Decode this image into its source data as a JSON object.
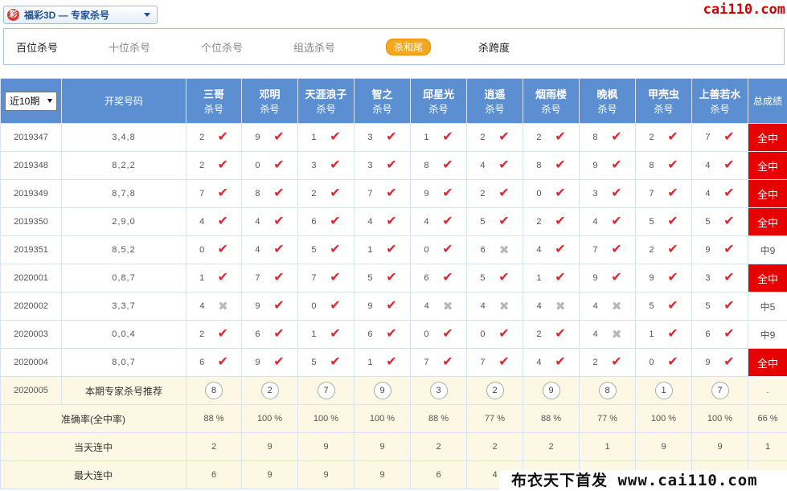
{
  "header": {
    "logo_glyph": "彩",
    "game_title": "福彩3D — 专家杀号",
    "site_mark": "cai110.com"
  },
  "tabs": [
    {
      "label": "百位杀号",
      "state": "selected-text"
    },
    {
      "label": "十位杀号",
      "state": "normal"
    },
    {
      "label": "个位杀号",
      "state": "normal"
    },
    {
      "label": "组选杀号",
      "state": "normal"
    },
    {
      "label": "杀和尾",
      "state": "active"
    },
    {
      "label": "杀跨度",
      "state": "dark"
    }
  ],
  "table": {
    "period_select": "近10期",
    "draw_header": "开奖号码",
    "result_header": "总成绩",
    "experts": [
      {
        "name": "三哥",
        "sub": "杀号"
      },
      {
        "name": "邓明",
        "sub": "杀号"
      },
      {
        "name": "天涯浪子",
        "sub": "杀号"
      },
      {
        "name": "智之",
        "sub": "杀号"
      },
      {
        "name": "邱星光",
        "sub": "杀号"
      },
      {
        "name": "逍遥",
        "sub": "杀号"
      },
      {
        "name": "烟雨楼",
        "sub": "杀号"
      },
      {
        "name": "晚枫",
        "sub": "杀号"
      },
      {
        "name": "甲壳虫",
        "sub": "杀号"
      },
      {
        "name": "上善若水",
        "sub": "杀号"
      }
    ],
    "rows": [
      {
        "issue": "2019347",
        "draw": "3,4,8",
        "picks": [
          "2",
          "9",
          "1",
          "3",
          "1",
          "2",
          "2",
          "8",
          "2",
          "7"
        ],
        "hits": [
          1,
          1,
          1,
          1,
          1,
          1,
          1,
          1,
          1,
          1
        ],
        "result": "全中"
      },
      {
        "issue": "2019348",
        "draw": "8,2,2",
        "picks": [
          "2",
          "0",
          "3",
          "3",
          "8",
          "4",
          "8",
          "9",
          "8",
          "4"
        ],
        "hits": [
          1,
          1,
          1,
          1,
          1,
          1,
          1,
          1,
          1,
          1
        ],
        "result": "全中"
      },
      {
        "issue": "2019349",
        "draw": "8,7,8",
        "picks": [
          "7",
          "8",
          "2",
          "7",
          "9",
          "2",
          "0",
          "3",
          "7",
          "4"
        ],
        "hits": [
          1,
          1,
          1,
          1,
          1,
          1,
          1,
          1,
          1,
          1
        ],
        "result": "全中"
      },
      {
        "issue": "2019350",
        "draw": "2,9,0",
        "picks": [
          "4",
          "4",
          "6",
          "4",
          "4",
          "5",
          "2",
          "4",
          "5",
          "5"
        ],
        "hits": [
          1,
          1,
          1,
          1,
          1,
          1,
          1,
          1,
          1,
          1
        ],
        "result": "全中"
      },
      {
        "issue": "2019351",
        "draw": "8,5,2",
        "picks": [
          "0",
          "4",
          "5",
          "1",
          "0",
          "6",
          "4",
          "7",
          "2",
          "9"
        ],
        "hits": [
          1,
          1,
          1,
          1,
          1,
          0,
          1,
          1,
          1,
          1
        ],
        "result": "中9"
      },
      {
        "issue": "2020001",
        "draw": "0,8,7",
        "picks": [
          "1",
          "7",
          "7",
          "5",
          "6",
          "5",
          "1",
          "9",
          "9",
          "3"
        ],
        "hits": [
          1,
          1,
          1,
          1,
          1,
          1,
          1,
          1,
          1,
          1
        ],
        "result": "全中"
      },
      {
        "issue": "2020002",
        "draw": "3,3,7",
        "picks": [
          "4",
          "9",
          "0",
          "9",
          "4",
          "4",
          "4",
          "4",
          "5",
          "5"
        ],
        "hits": [
          0,
          1,
          1,
          1,
          0,
          0,
          0,
          0,
          1,
          1
        ],
        "result": "中5"
      },
      {
        "issue": "2020003",
        "draw": "0,0,4",
        "picks": [
          "2",
          "6",
          "1",
          "6",
          "0",
          "0",
          "2",
          "4",
          "1",
          "6"
        ],
        "hits": [
          1,
          1,
          1,
          1,
          1,
          1,
          1,
          0,
          1,
          1
        ],
        "result": "中9"
      },
      {
        "issue": "2020004",
        "draw": "8,0,7",
        "picks": [
          "6",
          "9",
          "5",
          "1",
          "7",
          "7",
          "4",
          "2",
          "0",
          "9"
        ],
        "hits": [
          1,
          1,
          1,
          1,
          1,
          1,
          1,
          1,
          1,
          1
        ],
        "result": "全中"
      }
    ],
    "recommend": {
      "issue": "2020005",
      "label": "本期专家杀号推荐",
      "picks": [
        "8",
        "2",
        "7",
        "9",
        "3",
        "2",
        "9",
        "8",
        "1",
        "7"
      ],
      "result": "."
    },
    "stats": [
      {
        "label": "准确率(全中率)",
        "values": [
          "88 %",
          "100 %",
          "100 %",
          "100 %",
          "88 %",
          "77 %",
          "88 %",
          "77 %",
          "100 %",
          "100 %"
        ],
        "result": "66 %"
      },
      {
        "label": "当天连中",
        "values": [
          "2",
          "9",
          "9",
          "9",
          "2",
          "2",
          "2",
          "1",
          "9",
          "9"
        ],
        "result": "1"
      },
      {
        "label": "最大连中",
        "values": [
          "6",
          "9",
          "9",
          "9",
          "6",
          "4",
          "",
          "",
          "",
          "",
          ""
        ],
        "result": ""
      }
    ]
  },
  "watermark": "布衣天下首发 www.cai110.com",
  "icons": {
    "hit": "check-icon",
    "miss": "cross-icon"
  }
}
